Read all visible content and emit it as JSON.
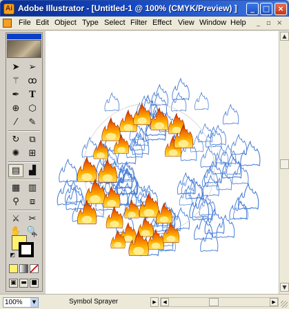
{
  "window": {
    "title": "Adobe Illustrator - [Untitled-1 @ 100% (CMYK/Preview) ]",
    "minimize_glyph": "_",
    "maximize_glyph": "□",
    "close_glyph": "×"
  },
  "menu": {
    "items": [
      "File",
      "Edit",
      "Object",
      "Type",
      "Select",
      "Filter",
      "Effect",
      "View",
      "Window",
      "Help"
    ],
    "doc_minimize": "_",
    "doc_restore": "▫",
    "doc_close": "×"
  },
  "toolbox": {
    "tools": [
      [
        "selection-arrow-icon",
        "direct-select-arrow-icon"
      ],
      [
        "magic-wand-icon",
        "lasso-icon"
      ],
      [
        "pen-icon",
        "type-icon"
      ],
      [
        "line-segment-icon",
        "ellipse-icon"
      ],
      [
        "paintbrush-icon",
        "pencil-icon"
      ],
      [
        "rotate-icon",
        "scale-icon"
      ],
      [
        "warp-icon",
        "free-transform-icon"
      ],
      [
        "symbol-sprayer-icon",
        "column-graph-icon"
      ],
      [
        "mesh-icon",
        "gradient-icon"
      ],
      [
        "eyedropper-icon",
        "blend-icon"
      ],
      [
        "slice-icon",
        "scissors-icon"
      ],
      [
        "hand-icon",
        "zoom-icon"
      ]
    ],
    "selected_tool": "symbol-sprayer-icon",
    "fill_color": "#fff26e",
    "stroke_color": "#000000"
  },
  "status": {
    "zoom": "100%",
    "tool_name": "Symbol Sprayer"
  },
  "canvas": {
    "symbol_outline_color": "#4a7fd6",
    "flame_colors": [
      "#c81e00",
      "#f06a00",
      "#ffb000",
      "#ffe15a"
    ]
  }
}
